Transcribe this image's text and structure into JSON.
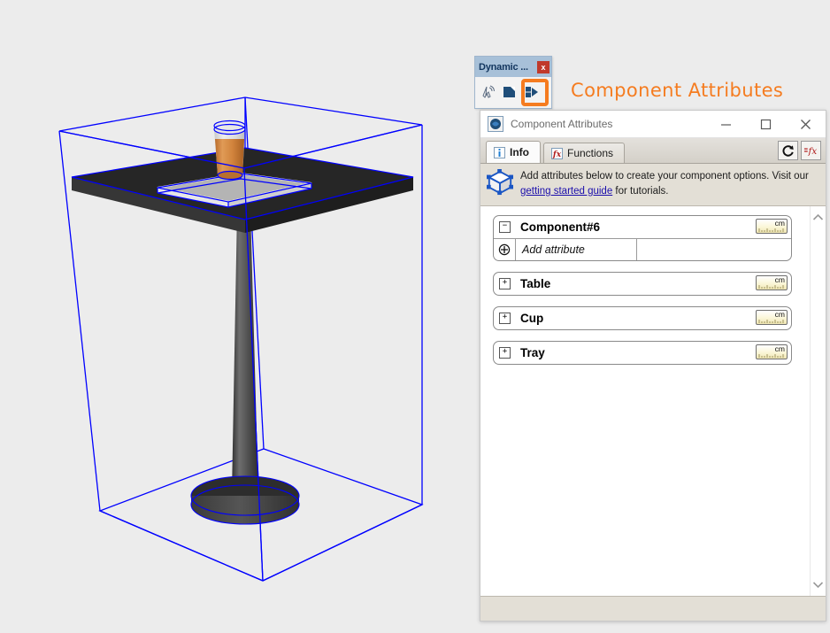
{
  "viewport": {
    "name": "sketchup-3d-viewport",
    "background_color": "#ececec",
    "selection_color": "#0000ff",
    "model": {
      "table_top_color": "#2b2b2b",
      "table_pole_color": "#4e4e4e",
      "tray_color": "#b4b4b4",
      "cup_liquid_color": "#d8873f",
      "cup_glass_color": "#d8d8d8"
    }
  },
  "dynamic_toolbar": {
    "title": "Dynamic ...",
    "close_label": "x",
    "buttons": [
      {
        "name": "interact-tool",
        "label": "Interact"
      },
      {
        "name": "component-options",
        "label": "Component Options"
      },
      {
        "name": "component-attributes",
        "label": "Component Attributes"
      }
    ]
  },
  "callout": {
    "label": "Component Attributes",
    "color": "#f57c20"
  },
  "dialog": {
    "title": "Component Attributes",
    "window_buttons": {
      "minimize": "Minimize",
      "maximize": "Maximize",
      "close": "Close"
    },
    "tabs": [
      {
        "label": "Info",
        "icon": "info-icon",
        "active": true
      },
      {
        "label": "Functions",
        "icon": "fx-icon",
        "active": false
      }
    ],
    "tab_tools": [
      {
        "name": "refresh-button",
        "icon": "refresh-icon"
      },
      {
        "name": "formula-button",
        "icon": "equals-fx-icon"
      }
    ],
    "hint": {
      "text_before": "Add attributes below to create your component options. Visit our ",
      "link_text": "getting started guide",
      "text_after": " for tutorials."
    },
    "attributes": [
      {
        "name": "Component#6",
        "expanded": true,
        "expander": "−",
        "unit": "cm",
        "rows": [
          {
            "field": "Add attribute",
            "value": ""
          }
        ]
      },
      {
        "name": "Table",
        "expanded": false,
        "expander": "+",
        "unit": "cm",
        "rows": []
      },
      {
        "name": "Cup",
        "expanded": false,
        "expander": "+",
        "unit": "cm",
        "rows": []
      },
      {
        "name": "Tray",
        "expanded": false,
        "expander": "+",
        "unit": "cm",
        "rows": []
      }
    ],
    "scrollbar": {
      "up": "scroll-up",
      "down": "scroll-down"
    }
  }
}
